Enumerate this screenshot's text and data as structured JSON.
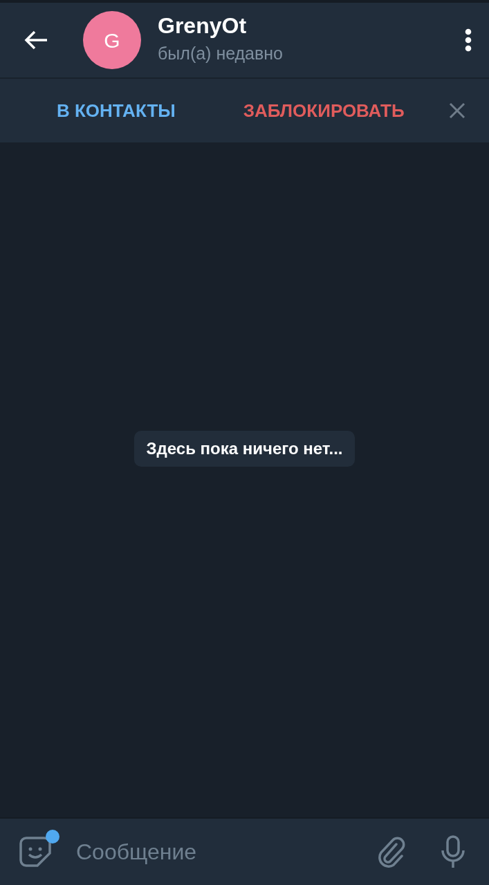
{
  "header": {
    "avatar_letter": "G",
    "title": "GrenyOt",
    "status": "был(а) недавно"
  },
  "action_bar": {
    "add_contact": "В КОНТАКТЫ",
    "block": "ЗАБЛОКИРОВАТЬ"
  },
  "chat": {
    "empty_notice": "Здесь пока ничего нет..."
  },
  "composer": {
    "placeholder": "Сообщение",
    "sticker_badge": true
  }
}
